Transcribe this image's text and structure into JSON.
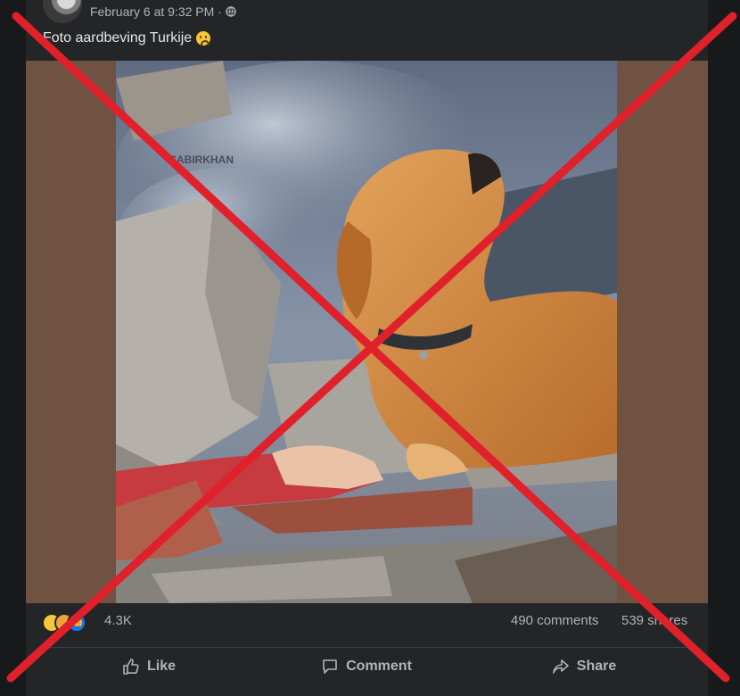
{
  "post": {
    "timestamp": "February 6 at 9:32 PM ·",
    "caption": "Foto aardbeving Turkije",
    "caption_emoji": "worried-face",
    "image_watermark": "SABIRKHAN",
    "privacy_icon": "globe-icon",
    "more_icon": "more-options-icon"
  },
  "stats": {
    "reaction_count": "4.3K",
    "comments": "490 comments",
    "shares": "539 shares"
  },
  "actions": {
    "like": "Like",
    "comment": "Comment",
    "share": "Share"
  },
  "colors": {
    "card_background": "#242526",
    "text_primary": "#e4e6eb",
    "text_secondary": "#b0b3b8",
    "media_background": "#6f5242",
    "overlay_cross": "#e0202b"
  }
}
